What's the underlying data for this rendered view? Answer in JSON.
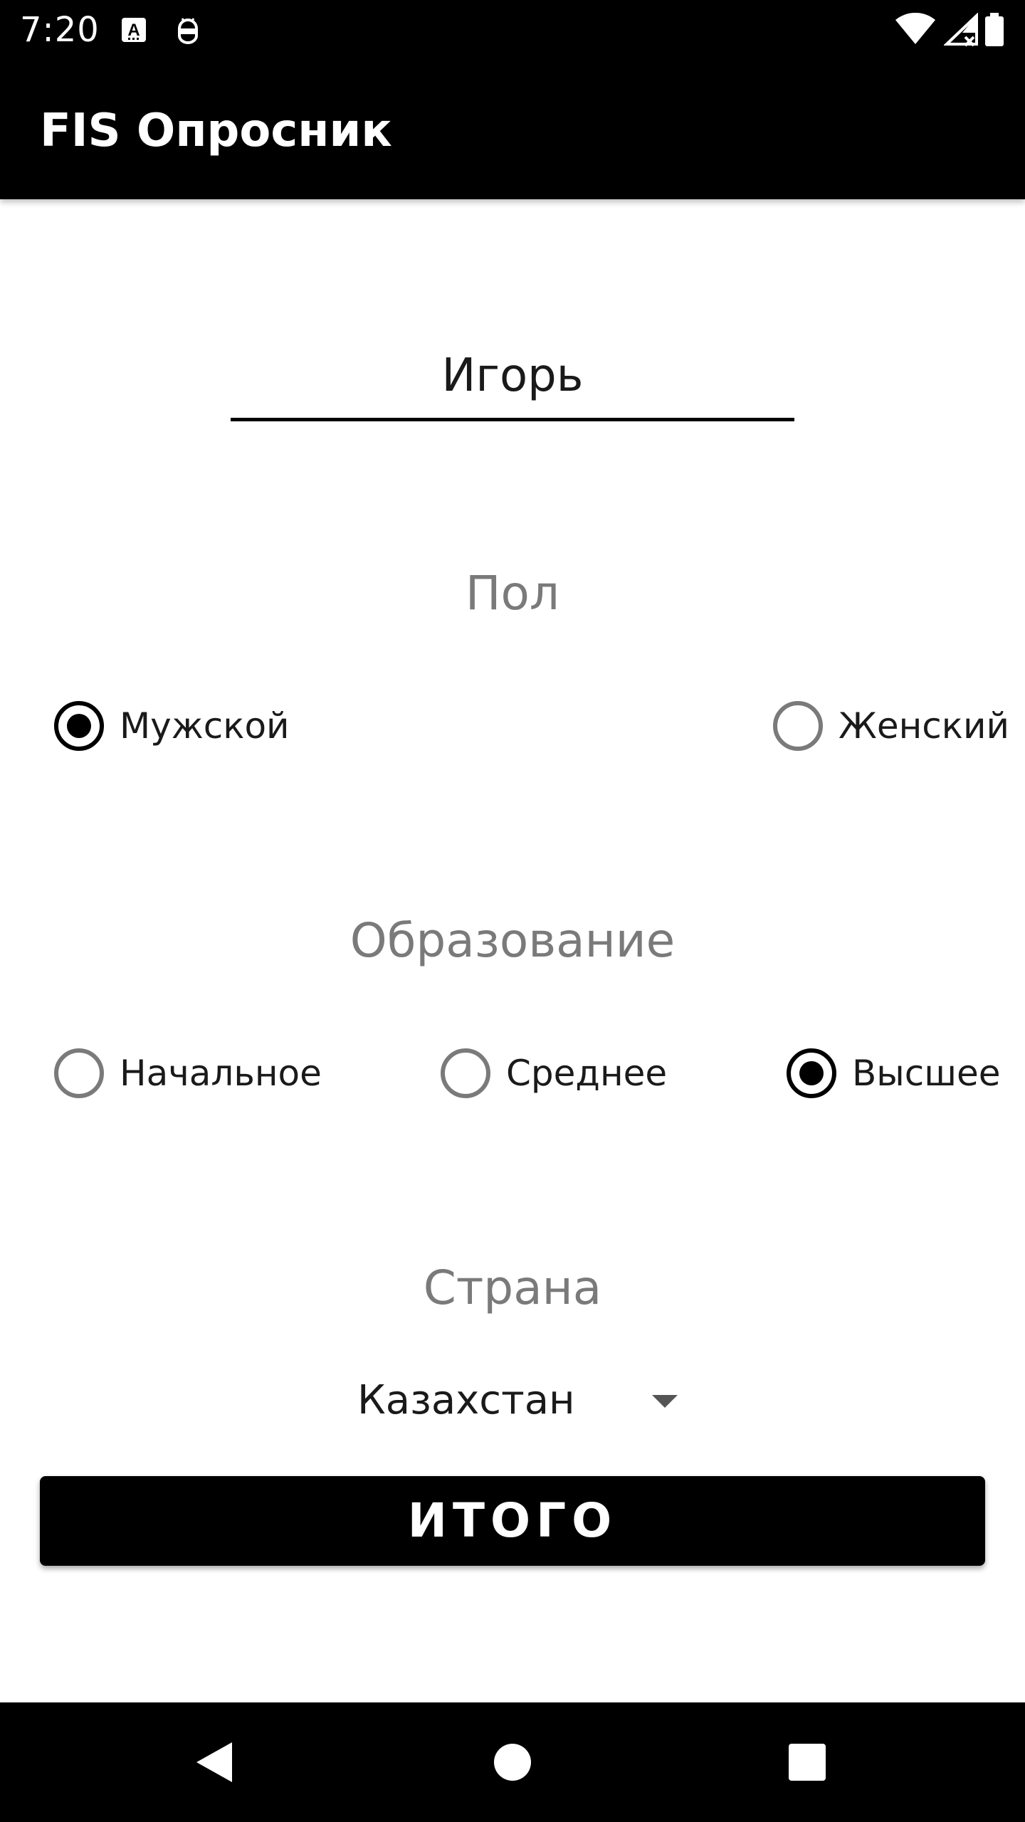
{
  "status_bar": {
    "time": "7:20"
  },
  "app_bar": {
    "title": "FIS Опросник"
  },
  "form": {
    "name_value": "Игорь",
    "gender": {
      "label": "Пол",
      "options": [
        {
          "label": "Мужской",
          "checked": true
        },
        {
          "label": "Женский",
          "checked": false
        }
      ]
    },
    "education": {
      "label": "Образование",
      "options": [
        {
          "label": "Начальное",
          "checked": false
        },
        {
          "label": "Среднее",
          "checked": false
        },
        {
          "label": "Высшее",
          "checked": true
        }
      ]
    },
    "country": {
      "label": "Страна",
      "selected": "Казахстан"
    },
    "submit_label": "ИТОГО"
  },
  "icons": {
    "notification_1": "a-keyboard-icon",
    "notification_2": "android-debug-icon",
    "wifi": "wifi-icon",
    "signal": "signal-icon",
    "battery": "battery-icon",
    "back": "back-icon",
    "home": "home-icon",
    "recents": "recents-icon"
  }
}
